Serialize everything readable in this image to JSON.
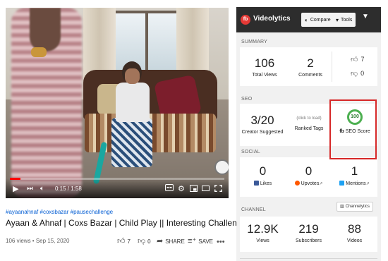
{
  "video": {
    "progress_fraction": 0.05,
    "time_display": "0:15 / 1:58",
    "hashtags": "#ayaanahnaf #coxsbazar #pausechallenge",
    "title": "Ayaan & Ahnaf | Coxs Bazar | Child Play || Interesting Challenge | Pause challenge",
    "views_date": "106 views • Sep 15, 2020",
    "likes": "7",
    "dislikes": "0",
    "share_label": "SHARE",
    "save_label": "SAVE",
    "more_label": "•••"
  },
  "videolytics": {
    "logo_text": "fb",
    "brand": "Videolytics",
    "compare_label": "Compare",
    "tools_label": "Tools",
    "summary": {
      "label": "SUMMARY",
      "total_views": "106",
      "total_views_label": "Total Views",
      "comments": "2",
      "comments_label": "Comments",
      "likes": "7",
      "dislikes": "0"
    },
    "seo": {
      "label": "SEO",
      "creator_suggested": "3/20",
      "creator_suggested_label": "Creator Suggested",
      "ranked_tags_hint": "(click to load)",
      "ranked_tags_label": "Ranked Tags",
      "score": "100",
      "score_label": "SEO Score"
    },
    "social": {
      "label": "SOCIAL",
      "likes": "0",
      "likes_label": "Likes",
      "upvotes": "0",
      "upvotes_label": "Upvotes",
      "mentions": "1",
      "mentions_label": "Mentions"
    },
    "channel": {
      "label": "CHANNEL",
      "button_label": "Channelytics",
      "views": "12.9K",
      "views_label": "Views",
      "subscribers": "219",
      "subscribers_label": "Subscribers",
      "videos": "88",
      "videos_label": "Videos"
    }
  },
  "colors": {
    "accent_red": "#ff0000",
    "seo_green": "#4caf50",
    "highlight_border": "#d62828",
    "link_blue": "#065fd4"
  }
}
